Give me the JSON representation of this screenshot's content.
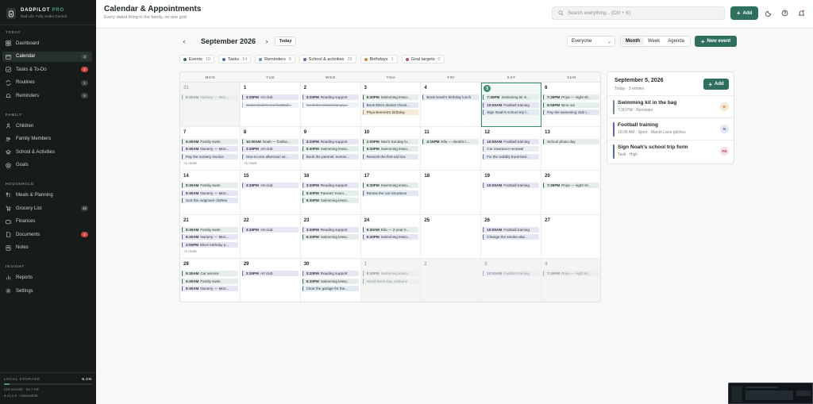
{
  "brand": {
    "name": "DADPILOT",
    "tag": "PRO",
    "subtitle": "Dad Life. Fully Under Control"
  },
  "sidebar": {
    "sections": [
      {
        "label": "TODAY",
        "items": [
          {
            "label": "Dashboard",
            "icon": "grid-icon"
          },
          {
            "label": "Calendar",
            "icon": "calendar-icon",
            "badge": "3",
            "active": true
          },
          {
            "label": "Tasks & To-Do",
            "icon": "check-square-icon",
            "badge": "2",
            "badge_style": "red"
          },
          {
            "label": "Routines",
            "icon": "repeat-icon",
            "badge": "1"
          },
          {
            "label": "Reminders",
            "icon": "bell-icon",
            "badge": "5"
          }
        ]
      },
      {
        "label": "FAMILY",
        "items": [
          {
            "label": "Children",
            "icon": "child-icon"
          },
          {
            "label": "Family Members",
            "icon": "users-icon"
          },
          {
            "label": "School & Activities",
            "icon": "school-icon"
          },
          {
            "label": "Goals",
            "icon": "target-icon"
          }
        ]
      },
      {
        "label": "HOUSEHOLD",
        "items": [
          {
            "label": "Meals & Planning",
            "icon": "utensils-icon"
          },
          {
            "label": "Grocery List",
            "icon": "cart-icon",
            "badge": "10"
          },
          {
            "label": "Finances",
            "icon": "wallet-icon"
          },
          {
            "label": "Documents",
            "icon": "file-icon",
            "badge": "2",
            "badge_style": "red"
          },
          {
            "label": "Notes",
            "icon": "note-icon"
          }
        ]
      },
      {
        "label": "INSIGHT",
        "items": [
          {
            "label": "Reports",
            "icon": "chart-icon"
          },
          {
            "label": "Settings",
            "icon": "gear-icon"
          }
        ]
      }
    ],
    "storage": {
      "label": "LOCAL STORAGE",
      "percent_label": "6.1%",
      "percent": 6.1,
      "detail": "218 records · 64.7 KB",
      "version": "● v1.0.0 · IndexedDB"
    }
  },
  "header": {
    "title": "Calendar & Appointments",
    "subtitle": "Every dated thing in the family, on one grid",
    "search_placeholder": "Search everything... (Ctrl + K)",
    "add_label": "Add"
  },
  "toolbar": {
    "month": "September 2026",
    "today_label": "Today",
    "filter": "Everyone",
    "views": [
      "Month",
      "Week",
      "Agenda"
    ],
    "active_view": "Month",
    "new_event_label": "New event"
  },
  "legend": [
    {
      "label": "Events",
      "count": "19",
      "color": "#2f6f60"
    },
    {
      "label": "Tasks",
      "count": "14",
      "color": "#4a6f9e"
    },
    {
      "label": "Reminders",
      "count": "8",
      "color": "#6e8aa5"
    },
    {
      "label": "School & activities",
      "count": "25",
      "color": "#6b5fb8"
    },
    {
      "label": "Birthdays",
      "count": "1",
      "color": "#c98a3a"
    },
    {
      "label": "Goal targets",
      "count": "0",
      "color": "#c24a72"
    }
  ],
  "calendar": {
    "weekdays": [
      "MON",
      "TUE",
      "WED",
      "THU",
      "FRI",
      "SAT",
      "SUN"
    ],
    "weeks": [
      [
        {
          "day": "31",
          "out": true,
          "events": [
            {
              "time": "9:30AM",
              "text": "Nursery — Mon...",
              "type": "event"
            }
          ]
        },
        {
          "day": "1",
          "events": [
            {
              "time": "3:30PM",
              "text": "Art club",
              "type": "school"
            },
            {
              "text": "Order Noah's new football...",
              "type": "task",
              "done": true
            }
          ]
        },
        {
          "day": "2",
          "events": [
            {
              "time": "3:20PM",
              "text": "Reading support",
              "type": "school"
            },
            {
              "text": "Send the school trip pay...",
              "type": "task",
              "done": true
            }
          ]
        },
        {
          "day": "3",
          "events": [
            {
              "time": "5:30PM",
              "text": "Swimming lesso...",
              "type": "event"
            },
            {
              "text": "Book Ella's dentist check...",
              "type": "task"
            },
            {
              "text": "Priya Bennett's birthday",
              "type": "birthday"
            }
          ]
        },
        {
          "day": "4",
          "events": [
            {
              "text": "Book Noah's birthday lunch",
              "type": "task"
            }
          ]
        },
        {
          "day": "5",
          "today": true,
          "events": [
            {
              "time": "7:30PM",
              "text": "Swimming kit in...",
              "type": "event"
            },
            {
              "time": "10:00AM",
              "text": "Football training",
              "type": "school"
            },
            {
              "text": "Sign Noah's school trip f...",
              "type": "task"
            }
          ]
        },
        {
          "day": "6",
          "events": [
            {
              "time": "7:30PM",
              "text": "Priya — night sh...",
              "type": "event"
            },
            {
              "time": "8:00PM",
              "text": "Bins out",
              "type": "event"
            },
            {
              "text": "Pay the swimming club t...",
              "type": "task"
            }
          ]
        }
      ],
      [
        {
          "day": "7",
          "events": [
            {
              "time": "9:30AM",
              "text": "Family swim",
              "type": "event"
            },
            {
              "time": "9:30AM",
              "text": "Nursery — Mon...",
              "type": "school"
            },
            {
              "text": "Pay the nursery invoice",
              "type": "task"
            }
          ],
          "more": "+1 more"
        },
        {
          "day": "8",
          "events": [
            {
              "time": "10:00AM",
              "text": "Noah — footba...",
              "type": "event"
            },
            {
              "time": "3:30PM",
              "text": "Art club",
              "type": "school"
            },
            {
              "text": "One-to-one afternoon wi...",
              "type": "task"
            }
          ],
          "more": "+1 more"
        },
        {
          "day": "9",
          "events": [
            {
              "time": "3:20PM",
              "text": "Reading support",
              "type": "school"
            },
            {
              "time": "5:30PM",
              "text": "Swimming lesso...",
              "type": "event"
            },
            {
              "text": "Book the parents' evenin...",
              "type": "task"
            }
          ]
        },
        {
          "day": "10",
          "events": [
            {
              "time": "1:00PM",
              "text": "Nan's Sunday lu...",
              "type": "event"
            },
            {
              "time": "5:30PM",
              "text": "Swimming lesso...",
              "type": "event"
            },
            {
              "text": "Restock the first-aid box",
              "type": "task"
            }
          ]
        },
        {
          "day": "11",
          "events": [
            {
              "time": "4:15PM",
              "text": "Ella — dentist c...",
              "type": "event"
            }
          ]
        },
        {
          "day": "12",
          "events": [
            {
              "time": "10:00AM",
              "text": "Football training",
              "type": "school"
            },
            {
              "text": "Car insurance renewal",
              "type": "reminder"
            },
            {
              "text": "Fix the wobbly bunk-bed...",
              "type": "task"
            }
          ]
        },
        {
          "day": "13",
          "events": [
            {
              "text": "School photo day",
              "type": "event"
            }
          ]
        }
      ],
      [
        {
          "day": "14",
          "events": [
            {
              "time": "9:30AM",
              "text": "Family swim",
              "type": "event"
            },
            {
              "time": "9:30AM",
              "text": "Nursery — Mon...",
              "type": "school"
            },
            {
              "text": "Sort the outgrown clothes",
              "type": "task"
            }
          ]
        },
        {
          "day": "15",
          "events": [
            {
              "time": "3:30PM",
              "text": "Art club",
              "type": "school"
            }
          ]
        },
        {
          "day": "16",
          "events": [
            {
              "time": "3:20PM",
              "text": "Reading support",
              "type": "school"
            },
            {
              "time": "5:30PM",
              "text": "Parents' eveni...",
              "type": "event"
            },
            {
              "time": "5:30PM",
              "text": "Swimming lesso...",
              "type": "event"
            }
          ]
        },
        {
          "day": "17",
          "events": [
            {
              "time": "5:30PM",
              "text": "Swimming lesso...",
              "type": "event"
            },
            {
              "text": "Renew the car insurance",
              "type": "task"
            }
          ]
        },
        {
          "day": "18",
          "events": []
        },
        {
          "day": "19",
          "events": [
            {
              "time": "10:00AM",
              "text": "Football training",
              "type": "school"
            }
          ]
        },
        {
          "day": "20",
          "events": [
            {
              "time": "7:30PM",
              "text": "Priya — night sh...",
              "type": "event"
            }
          ]
        }
      ],
      [
        {
          "day": "21",
          "events": [
            {
              "time": "9:30AM",
              "text": "Family swim",
              "type": "event"
            },
            {
              "time": "9:30AM",
              "text": "Nursery — Mon...",
              "type": "school"
            },
            {
              "time": "2:00PM",
              "text": "Ella's birthday p...",
              "type": "school"
            }
          ],
          "more": "+1 more"
        },
        {
          "day": "22",
          "events": [
            {
              "time": "3:30PM",
              "text": "Art club",
              "type": "school"
            }
          ]
        },
        {
          "day": "23",
          "events": [
            {
              "time": "3:20PM",
              "text": "Reading support",
              "type": "school"
            },
            {
              "time": "5:30PM",
              "text": "Swimming lesso...",
              "type": "event"
            }
          ]
        },
        {
          "day": "24",
          "events": [
            {
              "time": "9:30AM",
              "text": "Ella — 2-year h...",
              "type": "event"
            },
            {
              "time": "5:30PM",
              "text": "Swimming lesso...",
              "type": "school"
            }
          ]
        },
        {
          "day": "25",
          "events": []
        },
        {
          "day": "26",
          "events": [
            {
              "time": "10:00AM",
              "text": "Football training",
              "type": "school"
            },
            {
              "text": "Change the smoke-alar...",
              "type": "task"
            }
          ]
        },
        {
          "day": "27",
          "events": []
        }
      ],
      [
        {
          "day": "28",
          "events": [
            {
              "time": "9:30AM",
              "text": "Car service",
              "type": "event"
            },
            {
              "time": "9:30AM",
              "text": "Family swim",
              "type": "event"
            },
            {
              "time": "9:30AM",
              "text": "Nursery — Mon...",
              "type": "school"
            }
          ]
        },
        {
          "day": "29",
          "events": [
            {
              "time": "3:30PM",
              "text": "Art club",
              "type": "school"
            }
          ]
        },
        {
          "day": "30",
          "events": [
            {
              "time": "3:20PM",
              "text": "Reading support",
              "type": "school"
            },
            {
              "time": "5:30PM",
              "text": "Swimming lesso...",
              "type": "event"
            },
            {
              "text": "Clear the garage for the...",
              "type": "task"
            }
          ]
        },
        {
          "day": "1",
          "out": true,
          "events": [
            {
              "time": "5:30PM",
              "text": "Swimming lesso...",
              "type": "event"
            },
            {
              "text": "World Book Day costume",
              "type": "event"
            }
          ]
        },
        {
          "day": "2",
          "out": true,
          "events": []
        },
        {
          "day": "3",
          "out": true,
          "events": [
            {
              "time": "10:00AM",
              "text": "Football training",
              "type": "school"
            }
          ]
        },
        {
          "day": "4",
          "out": true,
          "events": [
            {
              "time": "7:30PM",
              "text": "Priya — night sh...",
              "type": "event"
            }
          ]
        }
      ]
    ]
  },
  "day_panel": {
    "date": "September 5, 2026",
    "summary": "Today · 3 entries",
    "add_label": "Add",
    "items": [
      {
        "title": "Swimming kit in the bag",
        "meta": "7:30 PM · Reminder",
        "avatar": "E",
        "bar": "#6e8aa5",
        "avatar_bg": "#f8e6d2",
        "avatar_fg": "#b8742c"
      },
      {
        "title": "Football training",
        "meta": "10:00 AM · Sport · Marsh Lane pitches",
        "avatar": "N",
        "bar": "#6b5fb8",
        "avatar_bg": "#e1e6f6",
        "avatar_fg": "#4a5fa8"
      },
      {
        "title": "Sign Noah's school trip form",
        "meta": "Task · High",
        "avatar": "PB",
        "bar": "#4a6f9e",
        "avatar_bg": "#f7dfe6",
        "avatar_fg": "#b8476a"
      }
    ]
  }
}
